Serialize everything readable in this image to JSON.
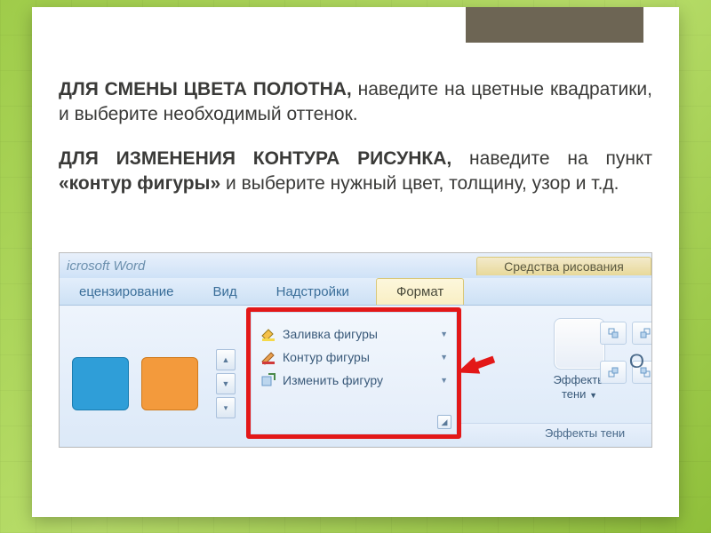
{
  "para1": {
    "bold": "ДЛЯ СМЕНЫ ЦВЕТА ПОЛОТНА,",
    "rest": " наведите на цветные квадратики, и выберите необходимый оттенок."
  },
  "para2": {
    "bold1": "ДЛЯ ИЗМЕНЕНИЯ КОНТУРА РИСУНКА,",
    "mid1": " наведите на пункт ",
    "bold2": "«контур фигуры»",
    "mid2": " и выберите нужный цвет, толщину, узор и т.д."
  },
  "ui": {
    "app": "icrosoft Word",
    "context_tab": "Средства рисования",
    "tabs": {
      "review": "ецензирование",
      "view": "Вид",
      "addins": "Надстройки",
      "format": "Формат"
    },
    "menu": {
      "fill": "Заливка фигуры",
      "outline": "Контур фигуры",
      "change": "Изменить фигуру"
    },
    "effects": {
      "label1": "Эффекты",
      "label2": "тени"
    },
    "groupfoot": "Эффекты тени",
    "crop_initial": "О"
  }
}
